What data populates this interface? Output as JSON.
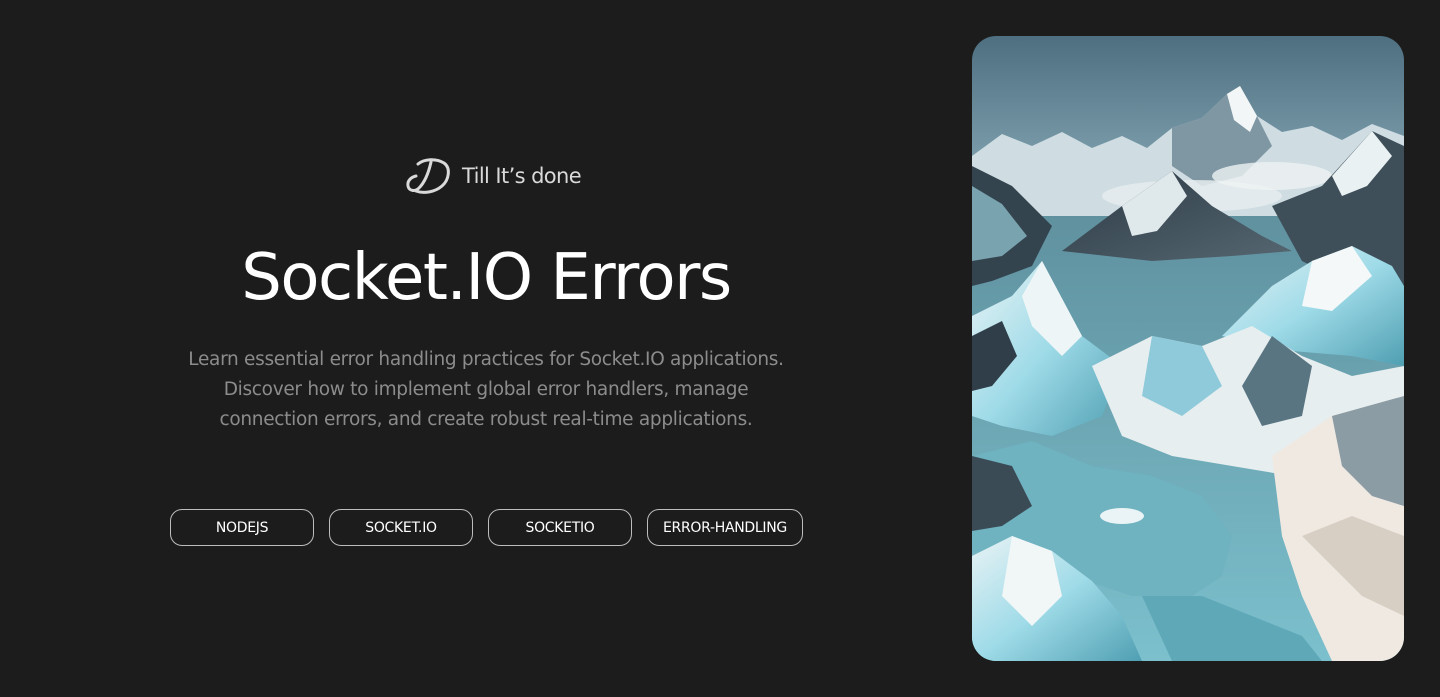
{
  "brand": {
    "name": "Till It’s done",
    "logo_icon": "td-monogram-logo"
  },
  "article": {
    "title": "Socket.IO Errors",
    "description_lines": [
      "Learn essential error handling practices for Socket.IO applications.",
      "Discover how to implement global error handlers, manage",
      "connection errors, and create robust real-time applications."
    ],
    "tags": [
      "NODEJS",
      "SOCKET.IO",
      "SOCKETIO",
      "ERROR-HANDLING"
    ]
  },
  "hero_image": {
    "subject": "icy-mountain-landscape",
    "colors": {
      "sky": "#6f9aab",
      "water": "#6fb2c0",
      "ice": "#8fd4e4",
      "snow": "#eef3f4",
      "rock": "#4a5660"
    }
  },
  "theme": {
    "background": "#1c1c1c",
    "title_color": "#ffffff",
    "text_muted": "#8c8c8c",
    "tag_border": "#bdbdbd"
  }
}
